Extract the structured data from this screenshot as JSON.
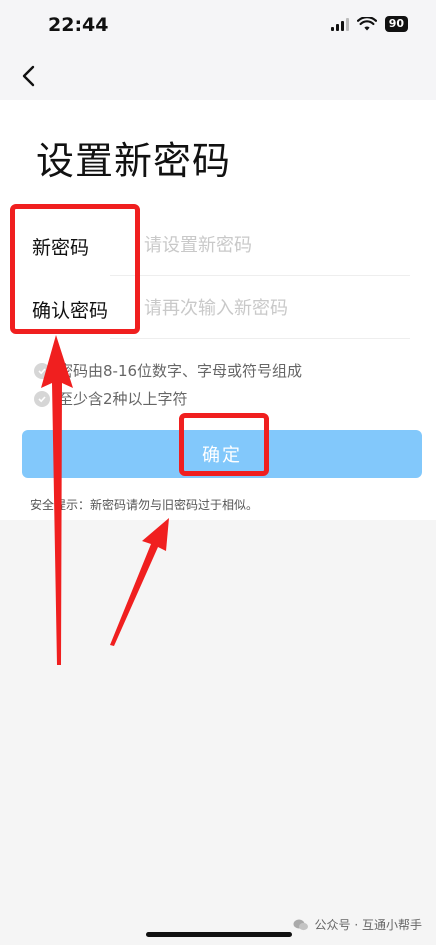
{
  "status_bar": {
    "time": "22:44",
    "battery": "90"
  },
  "page": {
    "title": "设置新密码"
  },
  "form": {
    "new_password": {
      "label": "新密码",
      "placeholder": "请设置新密码"
    },
    "confirm_password": {
      "label": "确认密码",
      "placeholder": "请再次输入新密码"
    }
  },
  "hints": [
    "密码由8-16位数字、字母或符号组成",
    "至少含2种以上字符"
  ],
  "confirm_button": {
    "label": "确定"
  },
  "security_tip": "安全提示：新密码请勿与旧密码过于相似。",
  "watermark": "公众号 · 互通小帮手",
  "colors": {
    "accent_button": "#82c8fb",
    "annotation": "#f01f1f"
  }
}
